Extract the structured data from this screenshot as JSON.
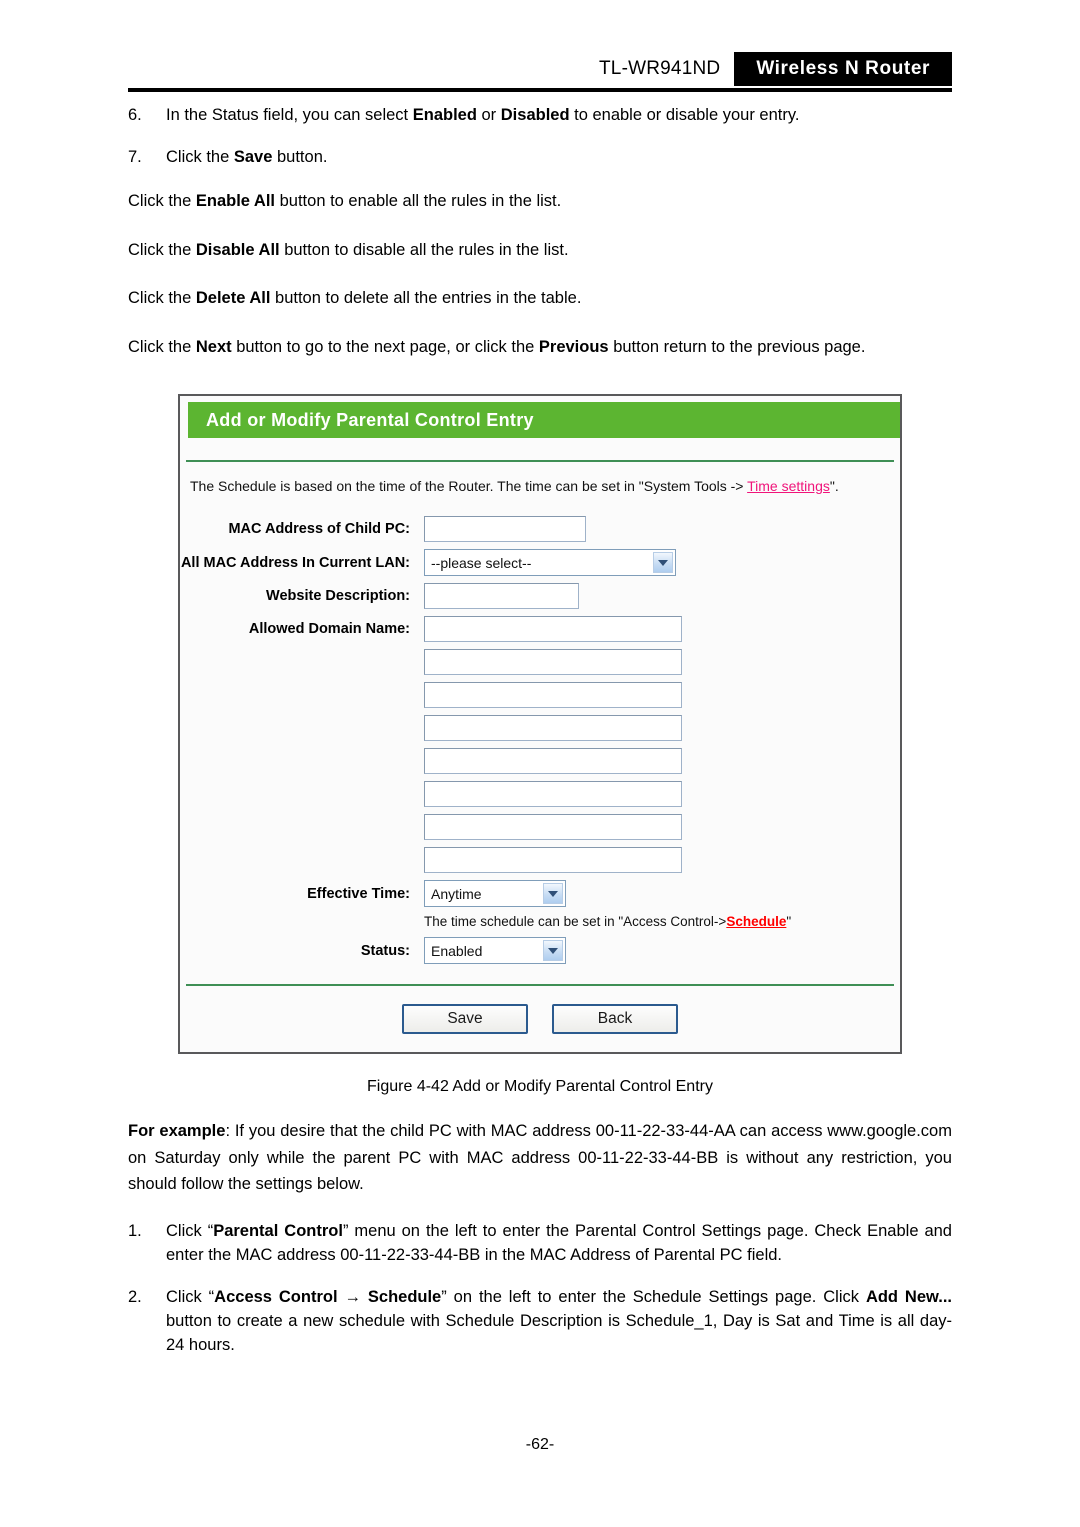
{
  "header": {
    "model": "TL-WR941ND",
    "brand": "Wireless N Router"
  },
  "steps_top": [
    {
      "num": "6.",
      "html": "In the Status field, you can select <b>Enabled</b> or <b>Disabled</b> to enable or disable your entry."
    },
    {
      "num": "7.",
      "html": "Click the <b>Save</b> button."
    }
  ],
  "paragraphs_top": [
    "Click the <b>Enable All</b> button to enable all the rules in the list.",
    "Click the <b>Disable All</b> button to disable all the rules in the list.",
    "Click the <b>Delete All</b> button to delete all the entries in the table.",
    "Click the <b>Next</b> button to go to the next page, or click the <b>Previous</b> button return to the previous page."
  ],
  "panel": {
    "title": "Add or Modify Parental Control Entry",
    "note_prefix": "The Schedule is based on the time of the Router. The time can be set in \"System Tools -> ",
    "note_link": "Time settings",
    "note_suffix": "\".",
    "labels": {
      "mac_child": "MAC Address of Child PC:",
      "all_mac_lan": "All MAC Address In Current LAN:",
      "website_desc": "Website Description:",
      "allowed_domain": "Allowed Domain Name:",
      "effective_time": "Effective Time:",
      "status": "Status:"
    },
    "values": {
      "mac_child": "",
      "all_mac_lan": "--please select--",
      "website_desc": "",
      "allowed_domain": [
        "",
        "",
        "",
        "",
        "",
        "",
        "",
        ""
      ],
      "effective_time": "Anytime",
      "status": "Enabled"
    },
    "schedule_hint_prefix": "The time schedule can be set in \"Access Control->",
    "schedule_hint_link": "Schedule",
    "schedule_hint_suffix": "\"",
    "buttons": {
      "save": "Save",
      "back": "Back"
    },
    "colors": {
      "title_green": "#5cb531",
      "divider_green": "#3f8f55",
      "link_pink": "#f0147a",
      "link_red": "#ff0000",
      "button_border": "#2b5a8e"
    }
  },
  "caption": "Figure 4-42   Add or Modify Parental Control Entry",
  "example": {
    "html": "<b>For example</b>: If you desire that the child PC with MAC address 00-11-22-33-44-AA can access www.google.com on Saturday only while the parent PC with MAC address 00-11-22-33-44-BB is without any restriction, you should follow the settings below."
  },
  "steps_bottom": [
    {
      "num": "1.",
      "html": "Click &ldquo;<b>Parental Control</b>&rdquo; menu on the left to enter the Parental Control Settings page. Check Enable and enter the MAC address 00-11-22-33-44-BB in the MAC Address of Parental PC field."
    },
    {
      "num": "2.",
      "html": "Click &ldquo;<b>Access Control &rarr; Schedule</b>&rdquo; on the left to enter the Schedule Settings page. Click <b>Add New...</b> button to create a new schedule with Schedule Description is Schedule_1, Day is Sat and Time is all day-24 hours."
    }
  ],
  "page_number": "-62-"
}
